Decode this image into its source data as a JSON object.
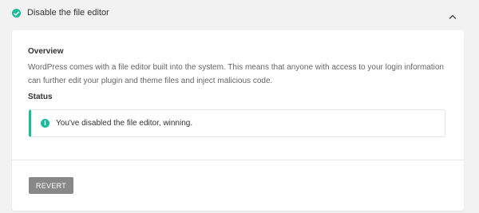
{
  "header": {
    "title": "Disable the file editor",
    "status_icon": "check-circle-icon",
    "toggle_icon": "chevron-up-icon"
  },
  "overview": {
    "heading": "Overview",
    "body": "WordPress comes with a file editor built into the system. This means that anyone with access to your login information can further edit your plugin and theme files and inject malicious code."
  },
  "status": {
    "heading": "Status",
    "notice_icon": "info-icon",
    "notice_glyph": "i",
    "notice_text": "You've disabled the file editor, winning."
  },
  "actions": {
    "revert_label": "REVERT"
  },
  "colors": {
    "accent": "#1abc9c",
    "button": "#888888",
    "background": "#f2f2f2"
  }
}
